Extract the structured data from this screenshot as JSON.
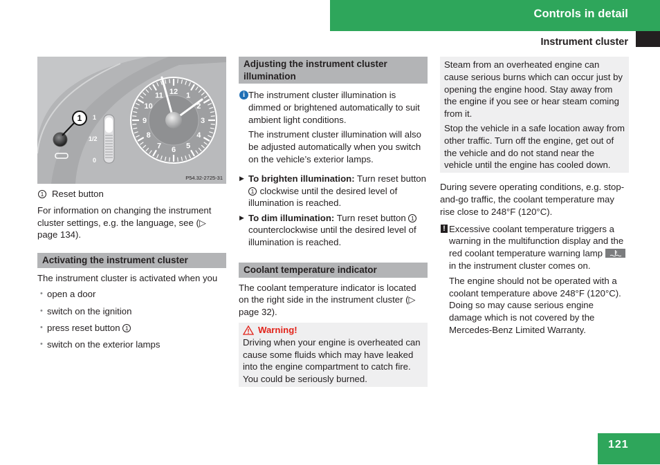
{
  "header": {
    "chapter_title": "Controls in detail",
    "section_title": "Instrument cluster",
    "accent_color": "#2ea65b"
  },
  "figure": {
    "image_code": "P54.32-2725-31",
    "callout_number": "1",
    "gauge_labels": [
      "1",
      "1/2",
      "0"
    ],
    "clock_numbers": [
      "12",
      "1",
      "2",
      "3",
      "4",
      "5",
      "6",
      "7",
      "8",
      "9",
      "10",
      "11"
    ]
  },
  "left_column": {
    "caption_number": "1",
    "caption_label": "Reset button",
    "info_text": "For information on changing the instrument cluster settings, e.g. the language, see (▷ page 134).",
    "activating_heading": "Activating the instrument cluster",
    "activating_intro": "The instrument cluster is activated when you",
    "activating_bullets": [
      {
        "text": "open a door"
      },
      {
        "text": "switch on the ignition"
      },
      {
        "text": "press reset button",
        "ref": "1"
      },
      {
        "text": "switch on the exterior lamps"
      }
    ]
  },
  "middle_column": {
    "illumination_heading": "Adjusting the instrument cluster illumination",
    "info_icon": "info-icon",
    "info_para1": "The instrument cluster illumination is dimmed or brightened automatically to suit ambient light conditions.",
    "info_para2": "The instrument cluster illumination will also be adjusted automatically when you switch on the vehicle’s exterior lamps.",
    "steps": [
      {
        "bold": "To brighten illumination:",
        "pre": " Turn reset button ",
        "ref": "1",
        "post": " clockwise until the desired level of illumination is reached."
      },
      {
        "bold": "To dim illumination:",
        "pre": " Turn reset button ",
        "ref": "1",
        "post": " counterclockwise until the desired level of illumination is reached."
      }
    ],
    "coolant_heading": "Coolant temperature indicator",
    "coolant_text": "The coolant temperature indicator is located on the right side in the instrument cluster (▷ page 32).",
    "warning_title": "Warning!",
    "warning_color": "#e2231a",
    "warning_text": "Driving when your engine is overheated can cause some fluids which may have leaked into the engine compartment to catch fire. You could be seriously burned."
  },
  "right_column": {
    "warning_cont_para1": "Steam from an overheated engine can cause serious burns which can occur just by opening the engine hood. Stay away from the engine if you see or hear steam coming from it.",
    "warning_cont_para2": "Stop the vehicle in a safe location away from other traffic. Turn off the engine, get out of the vehicle and do not stand near the vehicle until the engine has cooled down.",
    "operating_text": "During severe operating conditions, e.g. stop-and-go traffic, the coolant temperature may rise close to 248°F (120°C).",
    "notice_icon_label": "!",
    "notice_para1_pre": "Excessive coolant temperature triggers a warning in the multifunction display and the red coolant temperature warning lamp",
    "notice_para1_post": "in the instrument cluster comes on.",
    "notice_para2": "The engine should not be operated with a coolant temperature above 248°F (120°C). Doing so may cause serious engine damage which is not covered by the Mercedes-Benz Limited Warranty."
  },
  "footer": {
    "page_number": "121"
  }
}
